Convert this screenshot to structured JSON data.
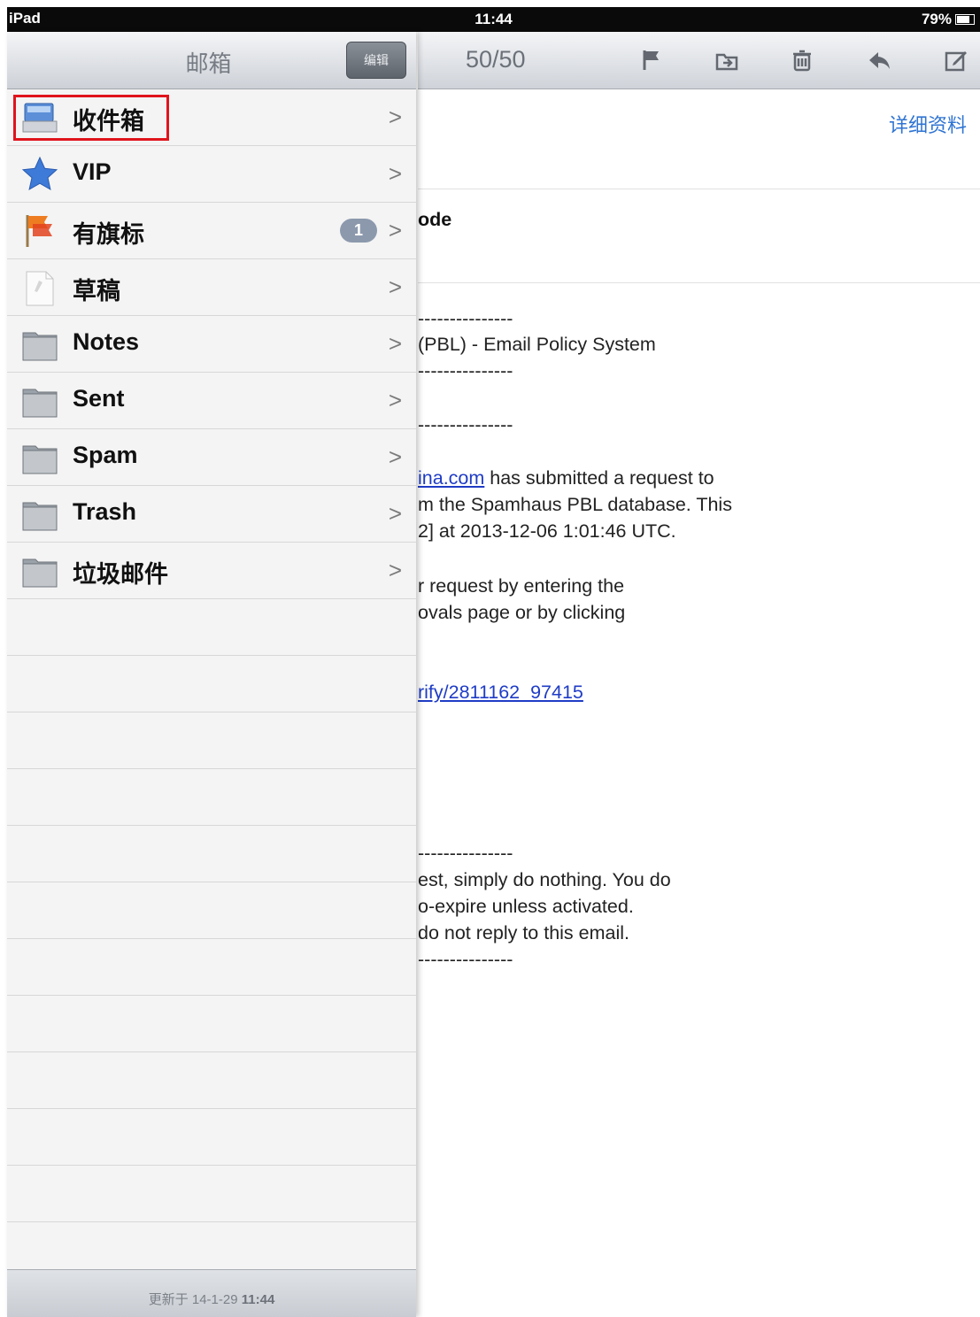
{
  "status_bar": {
    "device": "iPad",
    "time": "11:44",
    "battery": "79%",
    "battery_level": 0.79
  },
  "toolbar": {
    "counter": "50/50",
    "icons": [
      "flag-icon",
      "move-folder-icon",
      "trash-icon",
      "reply-icon",
      "compose-icon"
    ]
  },
  "panel": {
    "title": "邮箱",
    "edit_label": "编辑",
    "items": [
      {
        "label": "收件箱",
        "icon": "inbox-icon",
        "badge": ""
      },
      {
        "label": "VIP",
        "icon": "star-icon",
        "badge": ""
      },
      {
        "label": "有旗标",
        "icon": "flag-icon",
        "badge": "1"
      },
      {
        "label": "草稿",
        "icon": "draft-icon",
        "badge": ""
      },
      {
        "label": "Notes",
        "icon": "folder-icon",
        "badge": ""
      },
      {
        "label": "Sent",
        "icon": "folder-icon",
        "badge": ""
      },
      {
        "label": "Spam",
        "icon": "folder-icon",
        "badge": ""
      },
      {
        "label": "Trash",
        "icon": "folder-icon",
        "badge": ""
      },
      {
        "label": "垃圾邮件",
        "icon": "folder-icon",
        "badge": ""
      }
    ],
    "chevron": ">",
    "updated_prefix": "更新于",
    "updated_date": "14-1-29",
    "updated_time": "11:44"
  },
  "message": {
    "details_link": "详细资料",
    "subject_fragment": "ode",
    "lines": [
      {
        "text": "---------------"
      },
      {
        "text": "(PBL) - Email Policy System"
      },
      {
        "text": "---------------"
      },
      {
        "text": "---------------"
      },
      {
        "link": "ina.com",
        "text": " has submitted a request to"
      },
      {
        "text": "m the Spamhaus PBL database. This"
      },
      {
        "text": "2] at 2013-12-06 1:01:46 UTC."
      },
      {
        "text": "r request by entering the"
      },
      {
        "text": "ovals page or by clicking"
      },
      {
        "link": "rify/2811162_97415",
        "text": ""
      },
      {
        "text": "---------------"
      },
      {
        "text": "est, simply do nothing. You do"
      },
      {
        "text": "o-expire unless activated."
      },
      {
        "text": "do not reply to this email."
      },
      {
        "text": "---------------"
      }
    ]
  }
}
